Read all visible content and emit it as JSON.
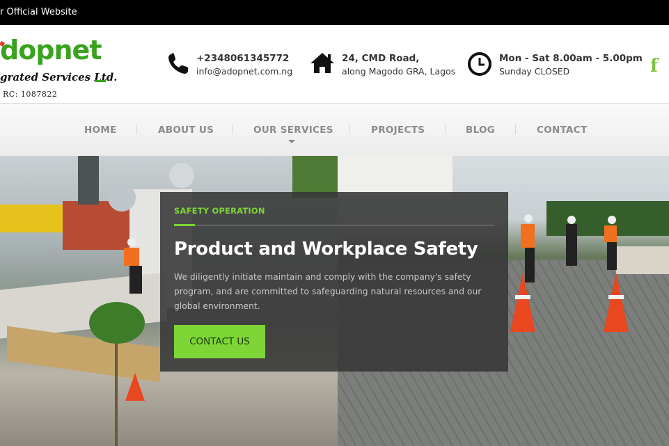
{
  "topbar": {
    "text": "r Official Website"
  },
  "logo": {
    "wordmark": "dopnet",
    "tagline": "grated Services Ltd.",
    "rc": "RC: 1087822"
  },
  "contact": {
    "phone": "+2348061345772",
    "email": "info@adopnet.com.ng",
    "address_line1": "24, CMD Road,",
    "address_line2": "along Magodo GRA, Lagos",
    "hours_line1": "Mon - Sat 8.00am - 5.00pm",
    "hours_line2": "Sunday CLOSED"
  },
  "social": {
    "facebook_glyph": "f"
  },
  "nav": {
    "items": [
      {
        "label": "HOME"
      },
      {
        "label": "ABOUT US"
      },
      {
        "label": "OUR SERVICES"
      },
      {
        "label": "PROJECTS"
      },
      {
        "label": "BLOG"
      },
      {
        "label": "CONTACT"
      }
    ]
  },
  "hero": {
    "kicker": "SAFETY OPERATION",
    "title": "Product and Workplace Safety",
    "description": "We diligently initiate maintain and comply with the company's safety program, and are committed to safeguarding natural resources and our global environment.",
    "cta": "CONTACT US"
  },
  "colors": {
    "accent_green": "#7dd636",
    "brand_green": "#3aa31e",
    "topbar_bg": "#000000",
    "overlay_bg": "#373737"
  },
  "icons": [
    "phone-icon",
    "home-icon",
    "clock-icon",
    "facebook-icon",
    "chevron-down-icon"
  ]
}
